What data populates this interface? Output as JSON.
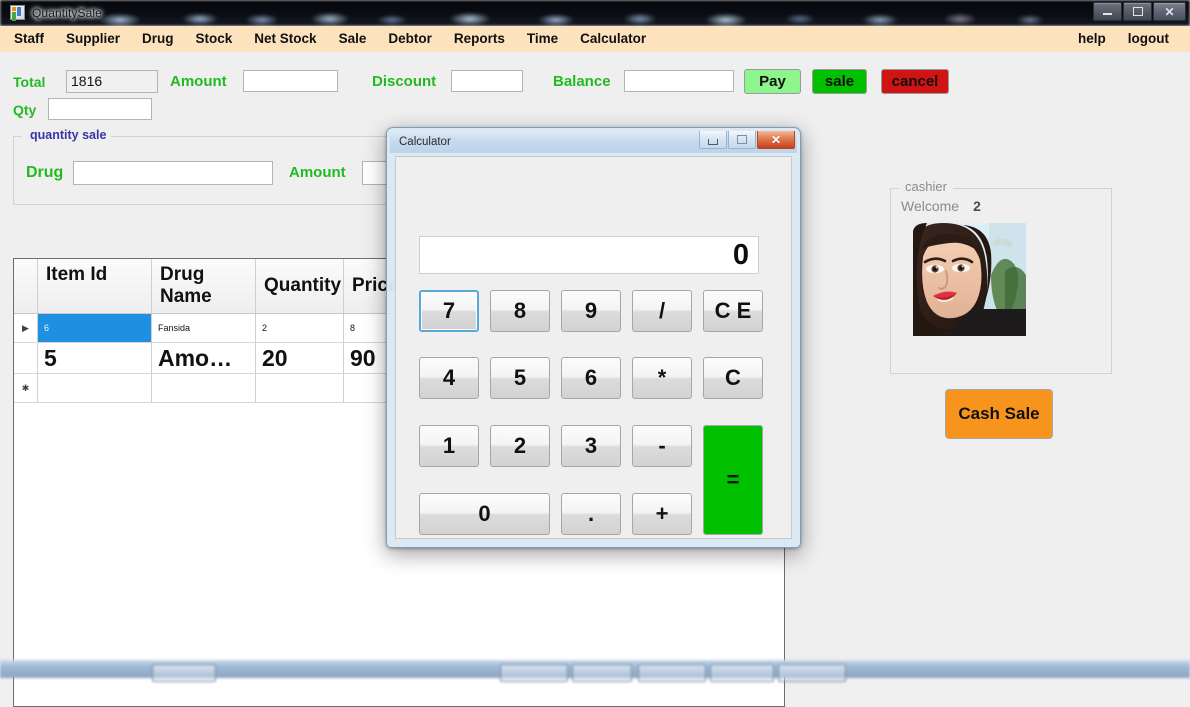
{
  "window": {
    "title": "QuantitySale",
    "icon": "app-icon",
    "buttons": {
      "minimize": "–",
      "maximize": "□",
      "close": "✕"
    }
  },
  "menu": {
    "items": [
      "Staff",
      "Supplier",
      "Drug",
      "Stock",
      "Net Stock",
      "Sale",
      "Debtor",
      "Reports",
      "Time",
      "Calculator"
    ],
    "right_items": [
      "help",
      "logout"
    ]
  },
  "header": {
    "total_label": "Total",
    "total_value": "1816",
    "qty_label": "Qty",
    "qty_value": "",
    "amount_label": "Amount",
    "amount_value": "",
    "discount_label": "Discount",
    "discount_value": "",
    "balance_label": "Balance",
    "balance_value": "",
    "pay_label": "Pay",
    "sale_label": "sale",
    "cancel_label": "cancel"
  },
  "quantity_sale": {
    "legend": "quantity sale",
    "drug_label": "Drug",
    "drug_value": "",
    "amount_label": "Amount",
    "amount_value": ""
  },
  "grid": {
    "columns": [
      "Item Id",
      "Drug Name",
      "Quantity",
      "Price",
      ""
    ],
    "rows": [
      {
        "marker": "▶",
        "selected": true,
        "size": "small",
        "cells": [
          "6",
          "Fansida",
          "2",
          "8",
          ""
        ]
      },
      {
        "marker": "",
        "selected": false,
        "size": "big",
        "cells": [
          "5",
          "Amo…",
          "20",
          "90",
          ""
        ]
      },
      {
        "marker": "✱",
        "selected": false,
        "size": "blank",
        "cells": [
          "",
          "",
          "",
          "",
          ""
        ]
      }
    ]
  },
  "cashier": {
    "legend": "cashier",
    "welcome_label": "Welcome",
    "welcome_value": "2",
    "photo_alt": "cashier-photo",
    "cash_sale_label": "Cash Sale"
  },
  "calculator": {
    "title": "Calculator",
    "display_value": "0",
    "buttons": {
      "minimize": "–",
      "maximize": "□",
      "close": "✕"
    },
    "keys": {
      "seven": "7",
      "eight": "8",
      "nine": "9",
      "divide": "/",
      "clear_entry": "C E",
      "four": "4",
      "five": "5",
      "six": "6",
      "multiply": "*",
      "clear": "C",
      "one": "1",
      "two": "2",
      "three": "3",
      "minus": "-",
      "equals": "=",
      "zero": "0",
      "dot": ".",
      "plus": "+"
    },
    "focused_key": "7"
  },
  "colors": {
    "menu_bar": "#fde3bd",
    "label_green": "#22b922",
    "pay": "#8cf58c",
    "sale": "#00c000",
    "cancel": "#d01414",
    "cash_sale": "#f7941d",
    "equals": "#00c000",
    "group_legend": "#3b35a8",
    "selection": "#1f8fe0"
  }
}
